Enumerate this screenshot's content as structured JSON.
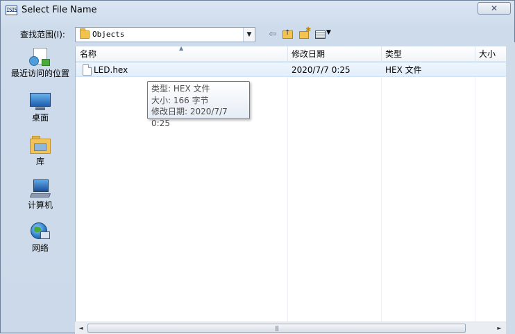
{
  "window": {
    "title": "Select File Name",
    "app_icon": "ISIS",
    "close_label": "✕"
  },
  "lookin": {
    "label": "查找范围(I):",
    "value": "Objects"
  },
  "toolbar": {
    "back_icon": "back-arrow-icon",
    "up_icon": "up-folder-icon",
    "new_folder_icon": "new-folder-icon",
    "view_icon": "view-menu-icon"
  },
  "places": [
    {
      "label": "最近访问的位置",
      "icon": "recent-places-icon"
    },
    {
      "label": "桌面",
      "icon": "desktop-icon"
    },
    {
      "label": "库",
      "icon": "libraries-icon"
    },
    {
      "label": "计算机",
      "icon": "computer-icon"
    },
    {
      "label": "网络",
      "icon": "network-icon"
    }
  ],
  "list": {
    "columns": [
      "名称",
      "修改日期",
      "类型",
      "大小"
    ],
    "rows": [
      {
        "name": "LED.hex",
        "modified": "2020/7/7 0:25",
        "type": "HEX 文件",
        "icon": "file-icon"
      }
    ]
  },
  "tooltip": {
    "line1": "类型: HEX 文件",
    "line2": "大小: 166 字节",
    "line3": "修改日期: 2020/7/7 0:25"
  },
  "scrollbar": {
    "left_arrow": "◄",
    "right_arrow": "►",
    "grip": "|||"
  },
  "colors": {
    "window_bg": "#cddbeb",
    "row_highlight": "#e2eefb",
    "folder": "#f2c44e"
  }
}
